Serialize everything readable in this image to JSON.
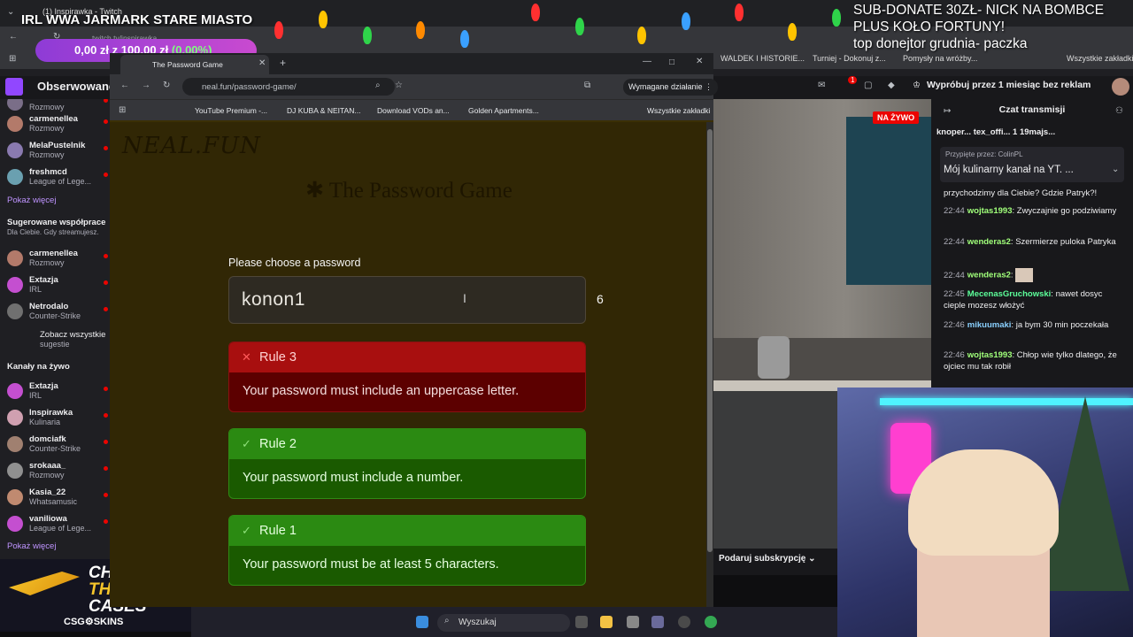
{
  "overlay": {
    "title": "IRL WWA JARMARK STARE MIASTO",
    "twitch_tab": "(1) Inspirawka - Twitch",
    "donate_current": "0,00 zł",
    "donate_sep": "z",
    "donate_goal": "100,00 zł",
    "donate_pct": "(0.00%)",
    "sub_donate_line1": "SUB-DONATE 30ZŁ- NICK NA BOMBCE",
    "sub_donate_line2": "PLUS KOŁO FORTUNY!",
    "sub_donate_line3": "top donejtor grudnia- paczka",
    "outer_address": "twitch.tv/inspirawka"
  },
  "outer_bookmarks": [
    "WALDEK I HISTORIE...",
    "Turniej - Dokonuj z...",
    "Pomysły na wróżby...",
    "Wszystkie zakładki"
  ],
  "twitch_header": {
    "followed": "Obserwowane",
    "promo": "Wypróbuj przez 1 miesiąc bez reklam",
    "notif_count": "1"
  },
  "sidebar": {
    "followed": [
      {
        "name": "",
        "cat": "Rozmowy"
      },
      {
        "name": "carmenellea",
        "cat": "Rozmowy"
      },
      {
        "name": "MelaPustelnik",
        "cat": "Rozmowy"
      },
      {
        "name": "freshmcd",
        "cat": "League of Lege..."
      }
    ],
    "show_more": "Pokaż więcej",
    "suggested_head": "Sugerowane współprace",
    "suggested_sub": "Dla Ciebie. Gdy streamujesz.",
    "suggested": [
      {
        "name": "carmenellea",
        "cat": "Rozmowy"
      },
      {
        "name": "Extazja",
        "cat": "IRL"
      },
      {
        "name": "Netrodalo",
        "cat": "Counter-Strike"
      }
    ],
    "see_all": "Zobacz wszystkie",
    "see_all_2": "sugestie",
    "live_head": "Kanały na żywo",
    "live": [
      {
        "name": "Extazja",
        "cat": "IRL"
      },
      {
        "name": "Inspirawka",
        "cat": "Kulinaria"
      },
      {
        "name": "domciafk",
        "cat": "Counter-Strike"
      },
      {
        "name": "srokaaa_",
        "cat": "Rozmowy"
      },
      {
        "name": "Kasia_22",
        "cat": "Whatsamusic"
      },
      {
        "name": "vaniliowa",
        "cat": "League of Lege..."
      }
    ],
    "show_more_2": "Pokaż więcej"
  },
  "ad": {
    "line1": "CHECK OUT",
    "line2": "THE BEST",
    "line3": "CASES",
    "brand": "CSG⚙SKINS"
  },
  "inner_browser": {
    "tab_title": "The Password Game",
    "url": "neal.fun/password-game/",
    "required_action": "Wymagane działanie",
    "bookmarks": [
      "YouTube Premium -...",
      "DJ KUBA & NEITAN...",
      "Download VODs an...",
      "Golden Apartments...",
      "Wszystkie zakładki"
    ]
  },
  "game": {
    "logo": "NEAL.FUN",
    "title": "✱ The Password Game",
    "label": "Please choose a password",
    "password": "konon1",
    "char_count": "6",
    "rules": [
      {
        "status": "fail",
        "icon": "✕",
        "title": "Rule 3",
        "text": "Your password must include an uppercase letter."
      },
      {
        "status": "pass",
        "icon": "✓",
        "title": "Rule 2",
        "text": "Your password must include a number."
      },
      {
        "status": "pass",
        "icon": "✓",
        "title": "Rule 1",
        "text": "Your password must be at least 5 characters."
      }
    ]
  },
  "stream": {
    "live_badge": "NA ŻYWO",
    "gift_sub": "Podaruj subskrypcję"
  },
  "chat": {
    "title": "Czat transmisji",
    "top_bar": "knoper... tex_offi... 1 19majs...",
    "pinned_by": "Przypięte przez: ColinPL",
    "pinned_msg": "Mój kulinarny kanał na YT. ...",
    "messages": [
      {
        "time": "",
        "user": "",
        "color": "#efeff1",
        "text": "przychodzimy dla Ciebie? Gdzie Patryk?!"
      },
      {
        "time": "22:44",
        "user": "wojtas1993",
        "color": "#a0ff7a",
        "text": "Zwyczajnie go podziwiamy"
      },
      {
        "time": "22:44",
        "user": "wenderas2",
        "color": "#a0ff7a",
        "text": "Szermierze puloka Patryka"
      },
      {
        "time": "22:44",
        "user": "wenderas2",
        "color": "#a0ff7a",
        "text": ""
      },
      {
        "time": "22:45",
        "user": "MecenasGruchowski",
        "color": "#5cff9a",
        "text": "nawet dosyc cieple mozesz włożyć"
      },
      {
        "time": "22:46",
        "user": "mikuumaki",
        "color": "#8ad0ff",
        "text": "ja bym 30 min poczekała"
      },
      {
        "time": "22:46",
        "user": "wojtas1993",
        "color": "#a0ff7a",
        "text": "Chłop wie tylko dlatego, że ojciec mu tak robił"
      }
    ]
  },
  "taskbar": {
    "search": "Wyszukaj"
  }
}
